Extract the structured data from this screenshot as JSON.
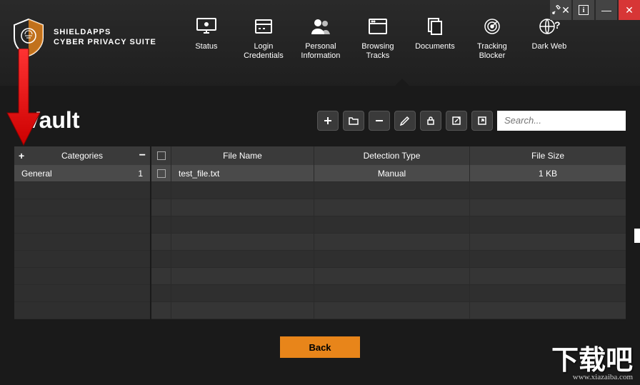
{
  "brand": {
    "top": "SHIELDAPPS",
    "bottom": "CYBER PRIVACY SUITE"
  },
  "nav": [
    {
      "label": "Status"
    },
    {
      "label": "Login\nCredentials"
    },
    {
      "label": "Personal\nInformation"
    },
    {
      "label": "Browsing\nTracks"
    },
    {
      "label": "Documents"
    },
    {
      "label": "Tracking\nBlocker"
    },
    {
      "label": "Dark Web"
    }
  ],
  "page": {
    "title": "Vault"
  },
  "search": {
    "placeholder": "Search..."
  },
  "categories": {
    "header": "Categories",
    "items": [
      {
        "name": "General",
        "count": "1"
      }
    ]
  },
  "columns": {
    "name": "File Name",
    "type": "Detection Type",
    "size": "File Size"
  },
  "files": [
    {
      "name": "test_file.txt",
      "type": "Manual",
      "size": "1 KB"
    }
  ],
  "back": "Back",
  "watermark": {
    "main": "下载吧",
    "url": "www.xiazaiba.com"
  }
}
